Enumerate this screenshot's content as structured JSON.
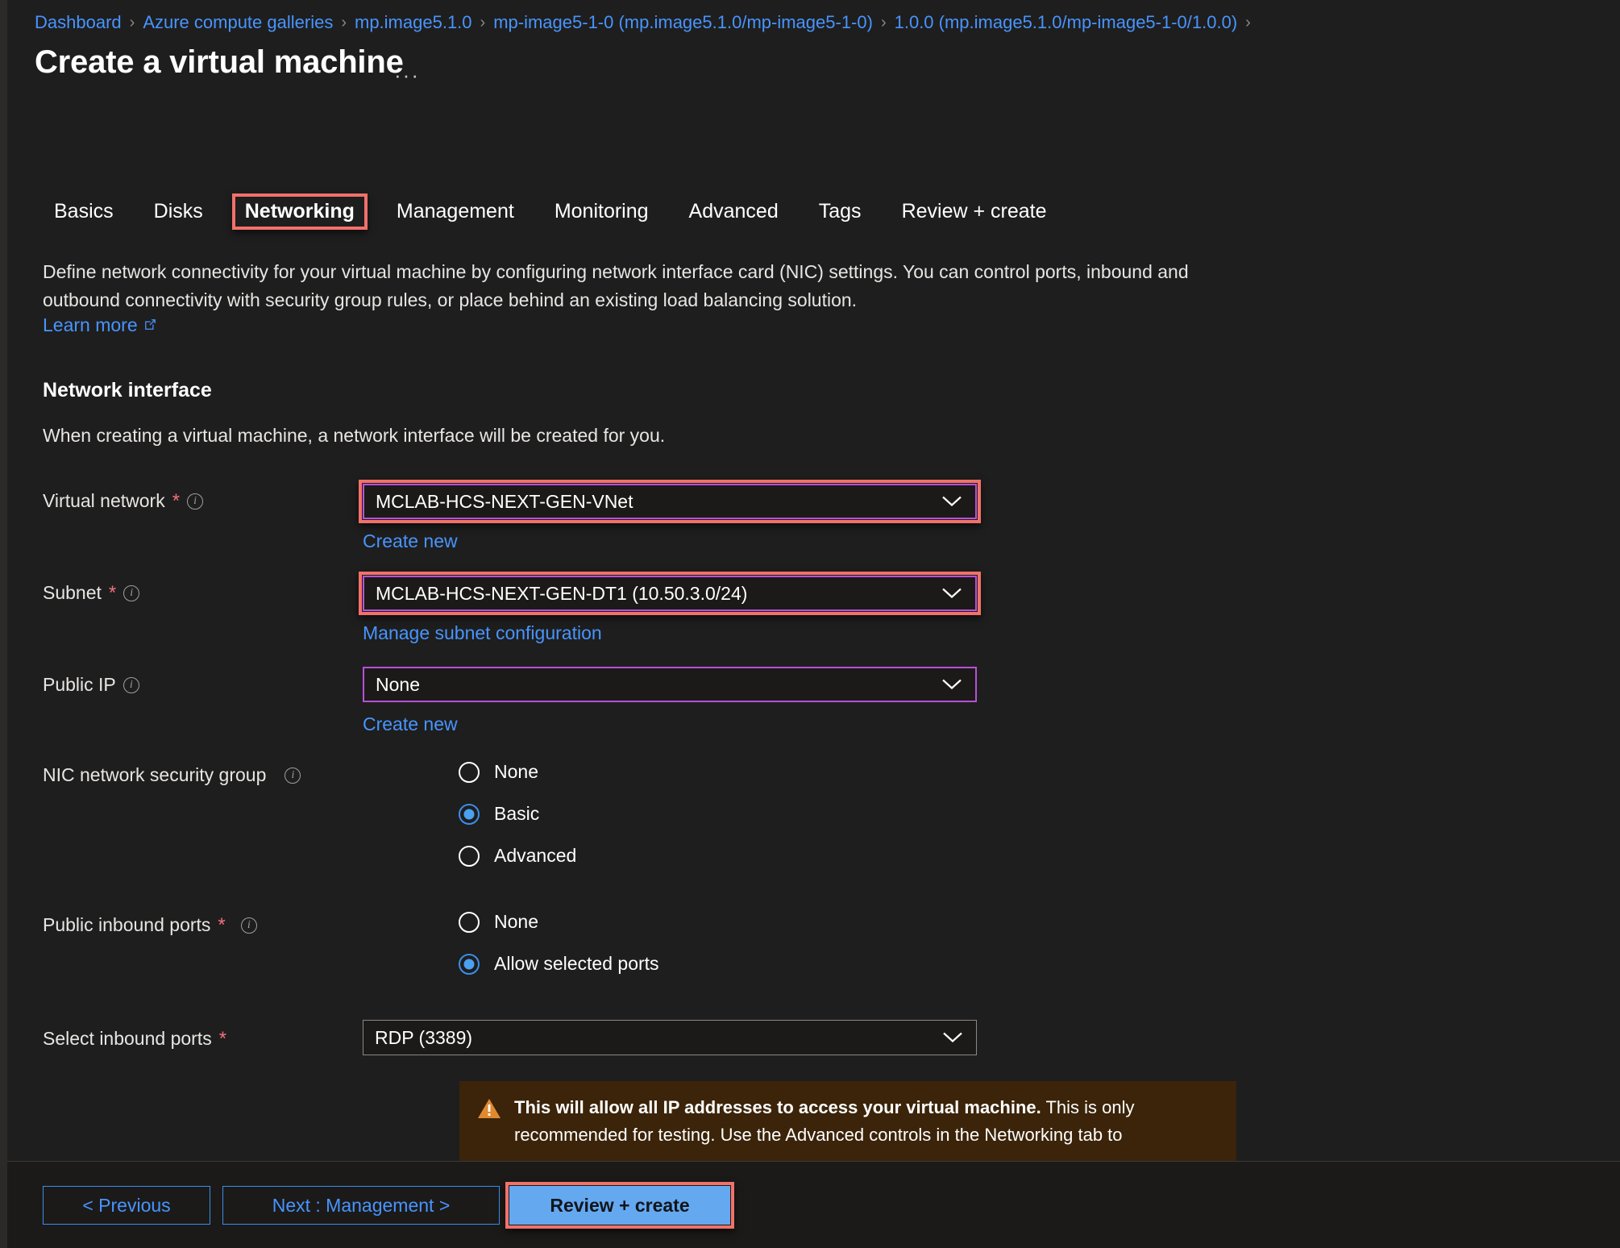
{
  "breadcrumb": {
    "items": [
      "Dashboard",
      "Azure compute galleries",
      "mp.image5.1.0",
      "mp-image5-1-0 (mp.image5.1.0/mp-image5-1-0)",
      "1.0.0 (mp.image5.1.0/mp-image5-1-0/1.0.0)"
    ],
    "separator": "›"
  },
  "header": {
    "title": "Create a virtual machine",
    "ellipsis": "···"
  },
  "tabs": [
    {
      "label": "Basics",
      "highlighted": false
    },
    {
      "label": "Disks",
      "highlighted": false
    },
    {
      "label": "Networking",
      "highlighted": true
    },
    {
      "label": "Management",
      "highlighted": false
    },
    {
      "label": "Monitoring",
      "highlighted": false
    },
    {
      "label": "Advanced",
      "highlighted": false
    },
    {
      "label": "Tags",
      "highlighted": false
    },
    {
      "label": "Review + create",
      "highlighted": false
    }
  ],
  "intro": {
    "description": "Define network connectivity for your virtual machine by configuring network interface card (NIC) settings. You can control ports, inbound and outbound connectivity with security group rules, or place behind an existing load balancing solution.",
    "learn_more": "Learn more"
  },
  "network_interface": {
    "heading": "Network interface",
    "subtext": "When creating a virtual machine, a network interface will be created for you."
  },
  "fields": {
    "virtual_network": {
      "label": "Virtual network",
      "required": "*",
      "value": "MCLAB-HCS-NEXT-GEN-VNet",
      "link": "Create new"
    },
    "subnet": {
      "label": "Subnet",
      "required": "*",
      "value": "MCLAB-HCS-NEXT-GEN-DT1 (10.50.3.0/24)",
      "link": "Manage subnet configuration"
    },
    "public_ip": {
      "label": "Public IP",
      "value": "None",
      "link": "Create new"
    },
    "nic_nsg": {
      "label": "NIC network security group",
      "options": [
        {
          "label": "None",
          "selected": false
        },
        {
          "label": "Basic",
          "selected": true
        },
        {
          "label": "Advanced",
          "selected": false
        }
      ]
    },
    "public_inbound_ports": {
      "label": "Public inbound ports",
      "required": "*",
      "options": [
        {
          "label": "None",
          "selected": false
        },
        {
          "label": "Allow selected ports",
          "selected": true
        }
      ]
    },
    "select_inbound_ports": {
      "label": "Select inbound ports",
      "required": "*",
      "value": "RDP (3389)"
    }
  },
  "warning": {
    "bold": "This will allow all IP addresses to access your virtual machine.",
    "rest": " This is only",
    "line2": "recommended for testing. Use the Advanced controls in the Networking tab to"
  },
  "footer": {
    "previous": "< Previous",
    "next": "Next : Management >",
    "review": "Review + create"
  },
  "colors": {
    "accent_blue": "#4894fe",
    "highlight_red": "#f2716a",
    "highlight_purple": "#b950d8",
    "warning_bg": "#3b2409",
    "primary_button": "#64a8f0"
  }
}
